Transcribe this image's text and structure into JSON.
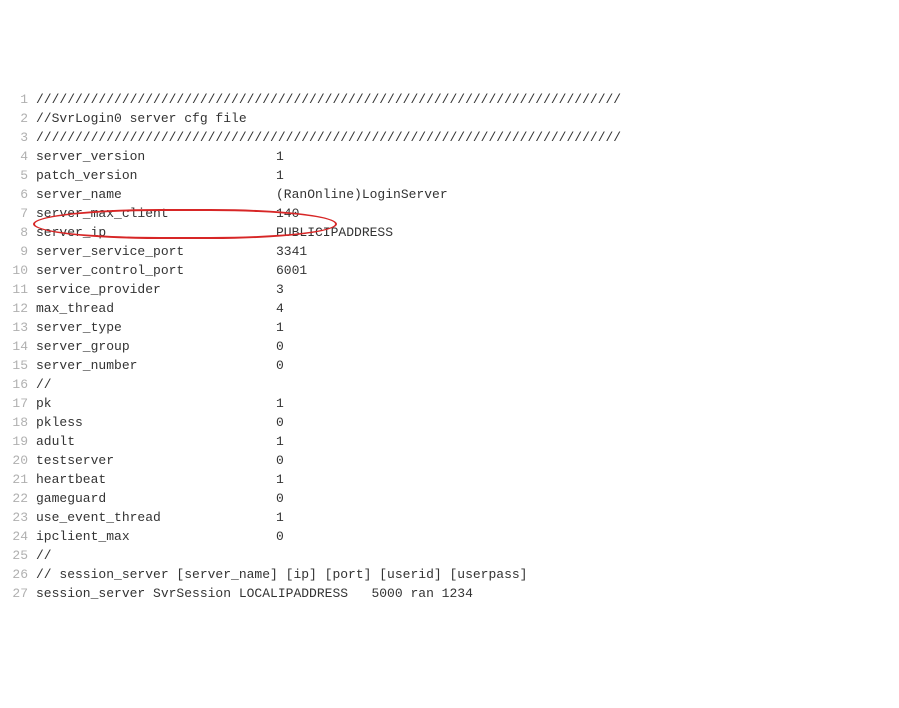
{
  "lines": [
    {
      "n": 1,
      "raw": "///////////////////////////////////////////////////////////////////////////"
    },
    {
      "n": 2,
      "raw": "//SvrLogin0 server cfg file"
    },
    {
      "n": 3,
      "raw": "///////////////////////////////////////////////////////////////////////////"
    },
    {
      "n": 4,
      "key": "server_version",
      "val": "1"
    },
    {
      "n": 5,
      "key": "patch_version",
      "val": "1"
    },
    {
      "n": 6,
      "key": "server_name",
      "val": "(RanOnline)LoginServer"
    },
    {
      "n": 7,
      "key": "server_max_client",
      "val": "140"
    },
    {
      "n": 8,
      "key": "server_ip",
      "val": "PUBLICIPADDRESS"
    },
    {
      "n": 9,
      "key": "server_service_port",
      "val": "3341"
    },
    {
      "n": 10,
      "key": "server_control_port",
      "val": "6001"
    },
    {
      "n": 11,
      "key": "service_provider",
      "val": "3"
    },
    {
      "n": 12,
      "key": "max_thread",
      "val": "4"
    },
    {
      "n": 13,
      "key": "server_type",
      "val": "1"
    },
    {
      "n": 14,
      "key": "server_group",
      "val": "0"
    },
    {
      "n": 15,
      "key": "server_number",
      "val": "0"
    },
    {
      "n": 16,
      "raw": "//"
    },
    {
      "n": 17,
      "key": "pk",
      "val": "1"
    },
    {
      "n": 18,
      "key": "pkless",
      "val": "0"
    },
    {
      "n": 19,
      "key": "adult",
      "val": "1"
    },
    {
      "n": 20,
      "key": "testserver",
      "val": "0"
    },
    {
      "n": 21,
      "key": "heartbeat",
      "val": "1"
    },
    {
      "n": 22,
      "key": "gameguard",
      "val": "0"
    },
    {
      "n": 23,
      "key": "use_event_thread",
      "val": "1"
    },
    {
      "n": 24,
      "key": "ipclient_max",
      "val": "0"
    },
    {
      "n": 25,
      "raw": "//"
    },
    {
      "n": 26,
      "raw": "// session_server [server_name] [ip] [port] [userid] [userpass]"
    },
    {
      "n": 27,
      "raw": "session_server SvrSession LOCALIPADDRESS   5000 ran 1234"
    }
  ],
  "annotation": {
    "highlighted_line": 9,
    "highlighted_key": "server_service_port",
    "highlighted_val": "3341",
    "color": "#d72626"
  }
}
